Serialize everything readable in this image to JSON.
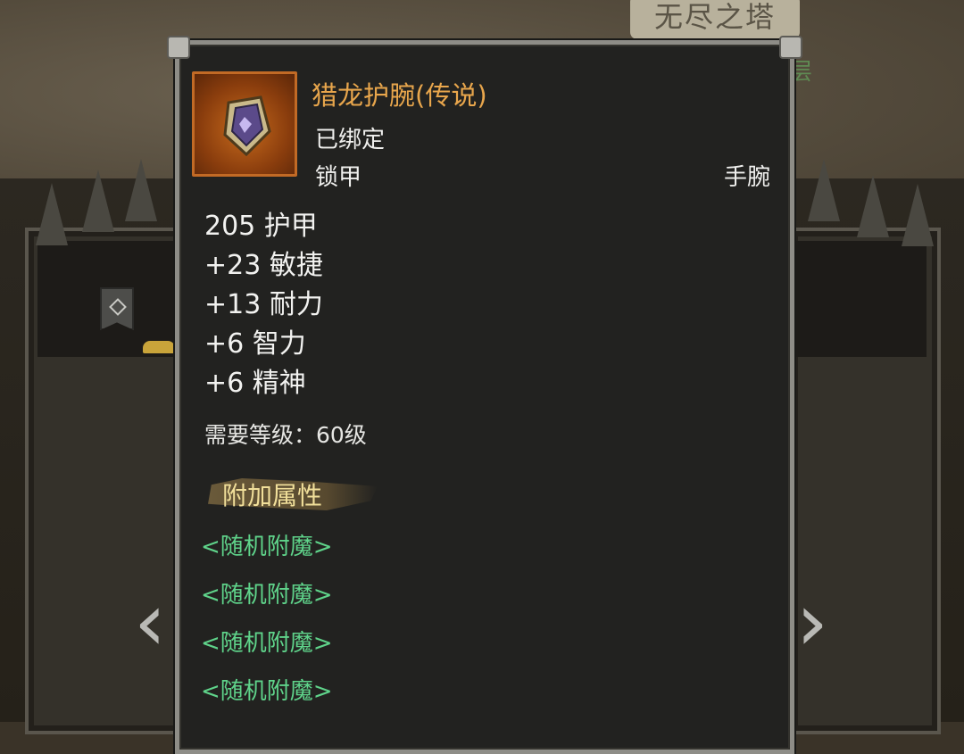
{
  "background": {
    "tower_title": "无尽之塔",
    "floor_text": "层",
    "nav_left_symbol": "‹",
    "nav_right_symbol": "›"
  },
  "tooltip": {
    "item_icon": "bracer-icon",
    "name": "猎龙护腕(传说)",
    "bound": "已绑定",
    "armor_type": "锁甲",
    "slot": "手腕",
    "stats": [
      "205 护甲",
      "+23 敏捷",
      "+13 耐力",
      "+6 智力",
      "+6 精神"
    ],
    "required_level": "需要等级：60级",
    "bonus_header": "附加属性",
    "enchants": [
      "<随机附魔>",
      "<随机附魔>",
      "<随机附魔>",
      "<随机附魔>"
    ]
  },
  "colors": {
    "legendary_name": "#e8a64c",
    "enchant_green": "#5fd38a",
    "bonus_gold": "#f1df9a",
    "panel_bg": "#222220"
  }
}
